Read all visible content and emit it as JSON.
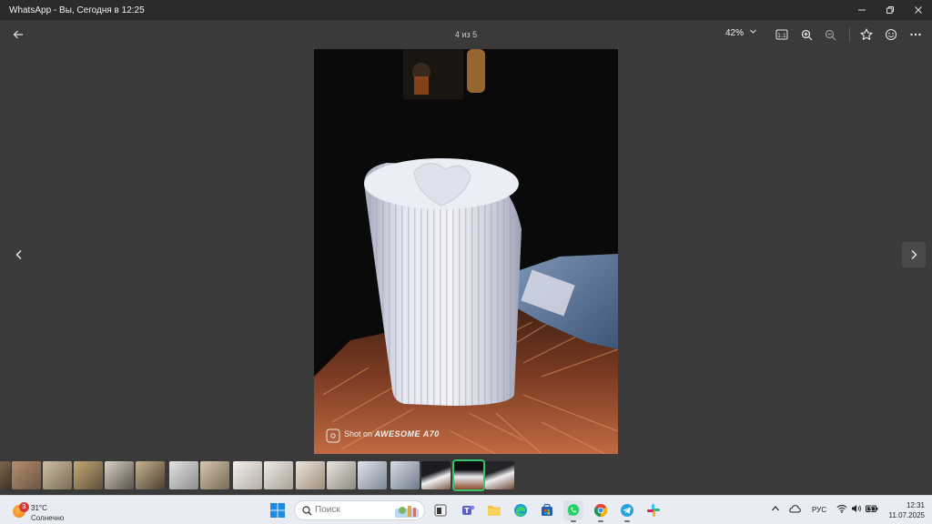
{
  "window": {
    "title": "WhatsApp - Вы, Сегодня в 12:25",
    "controls": [
      "minimize",
      "restore",
      "close"
    ]
  },
  "toolbar": {
    "counter": "4 из 5",
    "zoom": "42%",
    "icons": [
      "back-arrow-icon",
      "actual-size-icon",
      "zoom-in-icon",
      "zoom-out-icon",
      "star-icon",
      "emoji-icon"
    ]
  },
  "photo": {
    "watermark": "Shot on AWESOME A70",
    "watermark_brand": "AWESOME A70",
    "watermark_prefix": "Shot on"
  },
  "filmstrip": {
    "thumb_count": 16,
    "active_index": 14
  },
  "taskbar": {
    "weather": {
      "badge": "3",
      "temp": "31°C",
      "condition": "Солнечно"
    },
    "search": {
      "placeholder": "Поиск"
    },
    "apps": [
      "start",
      "search",
      "widgets",
      "terminal",
      "teams",
      "file-explorer",
      "edge",
      "store",
      "whatsapp",
      "chrome",
      "telegram",
      "slack"
    ],
    "tray": {
      "language": "РУС",
      "time": "12:31",
      "date": "11.07.2025"
    }
  },
  "colors": {
    "accent_active_thumb": "#35c46a",
    "viewer_bg": "#3a3a3a",
    "taskbar_bg": "#e9edf3"
  }
}
